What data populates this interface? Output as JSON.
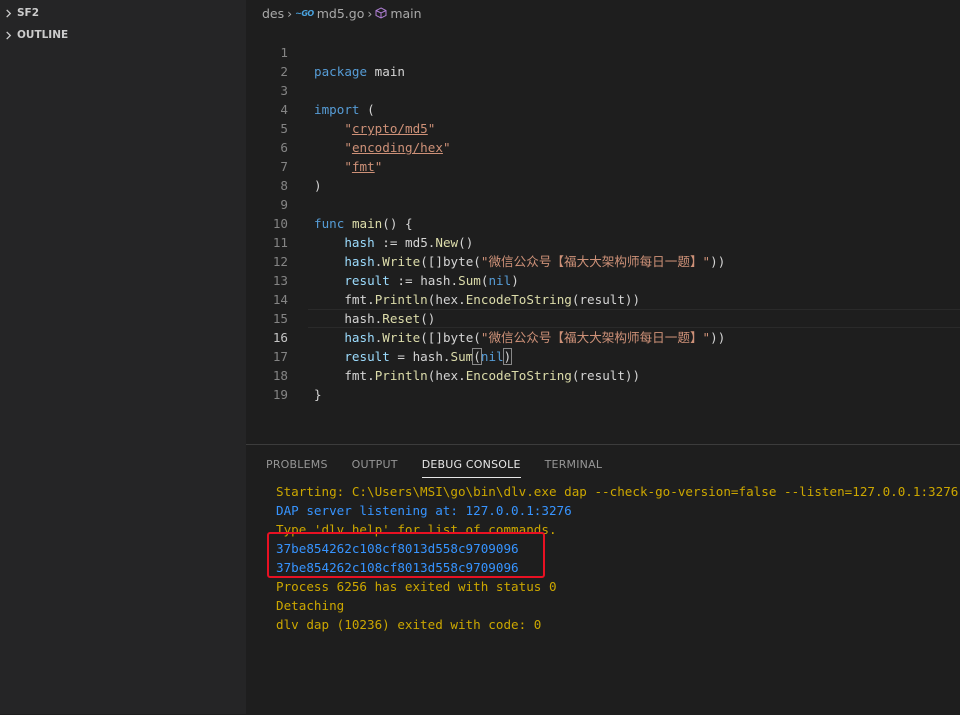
{
  "sidebar": {
    "sections": [
      {
        "label": "SF2",
        "expanded": false
      },
      {
        "label": "OUTLINE",
        "expanded": false
      }
    ]
  },
  "breadcrumb": {
    "folder": "des",
    "file_icon": "go",
    "file": "md5.go",
    "symbol": "main"
  },
  "editor": {
    "current_line": 16,
    "lines": [
      {
        "n": "1"
      },
      {
        "n": "2"
      },
      {
        "n": "3"
      },
      {
        "n": "4"
      },
      {
        "n": "5"
      },
      {
        "n": "6"
      },
      {
        "n": "7"
      },
      {
        "n": "8"
      },
      {
        "n": "9"
      },
      {
        "n": "10"
      },
      {
        "n": "11"
      },
      {
        "n": "12"
      },
      {
        "n": "13"
      },
      {
        "n": "14"
      },
      {
        "n": "15"
      },
      {
        "n": "16"
      },
      {
        "n": "17"
      },
      {
        "n": "18"
      },
      {
        "n": "19"
      }
    ],
    "tokens": {
      "package": "package",
      "main": "main",
      "import": "import",
      "lparen": "(",
      "rparen": ")",
      "q": "\"",
      "crypto_md5": "crypto/md5",
      "encoding_hex": "encoding/hex",
      "fmt": "fmt",
      "func": "func",
      "main_sig": "() {",
      "hash": "hash",
      "decl": " := ",
      "md5_pkg": "md5.",
      "New": "New",
      "call_empty": "()",
      "Write": "Write",
      "byte_conv": "([]byte(",
      "chinese": "\"微信公众号【福大大架构师每日一题】\"",
      "close2": "))",
      "result": "result",
      "hash_dot": "hash.",
      "Sum": "Sum",
      "nil": "nil",
      "paren_l": "(",
      "paren_r": ")",
      "fmt_dot": "fmt.",
      "Println": "Println",
      "hex_dot": "hex.",
      "EncodeToString": "EncodeToString",
      "result_arg": "(result))",
      "Reset": "Reset",
      "assign": " = ",
      "brace_close": "}"
    }
  },
  "panel": {
    "tabs": [
      "PROBLEMS",
      "OUTPUT",
      "DEBUG CONSOLE",
      "TERMINAL"
    ],
    "active_tab": "DEBUG CONSOLE",
    "console_lines": [
      {
        "text": "Starting: C:\\Users\\MSI\\go\\bin\\dlv.exe dap --check-go-version=false --listen=127.0.0.1:3276",
        "color": "orange"
      },
      {
        "text": "DAP server listening at: 127.0.0.1:3276",
        "color": "blue"
      },
      {
        "text": "Type 'dlv help' for list of commands.",
        "color": "orange"
      },
      {
        "text": "37be854262c108cf8013d558c9709096",
        "color": "blue"
      },
      {
        "text": "37be854262c108cf8013d558c9709096",
        "color": "blue"
      },
      {
        "text": "Process 6256 has exited with status 0",
        "color": "orange"
      },
      {
        "text": "Detaching",
        "color": "orange"
      },
      {
        "text": "dlv dap (10236) exited with code: 0",
        "color": "orange"
      }
    ]
  },
  "colors": {
    "keyword": "#569cd6",
    "string": "#ce9178",
    "function": "#dcdcaa",
    "variable": "#9cdcfe",
    "console_orange": "#cca700",
    "console_blue": "#3794ff",
    "highlight_box": "#e81123"
  }
}
